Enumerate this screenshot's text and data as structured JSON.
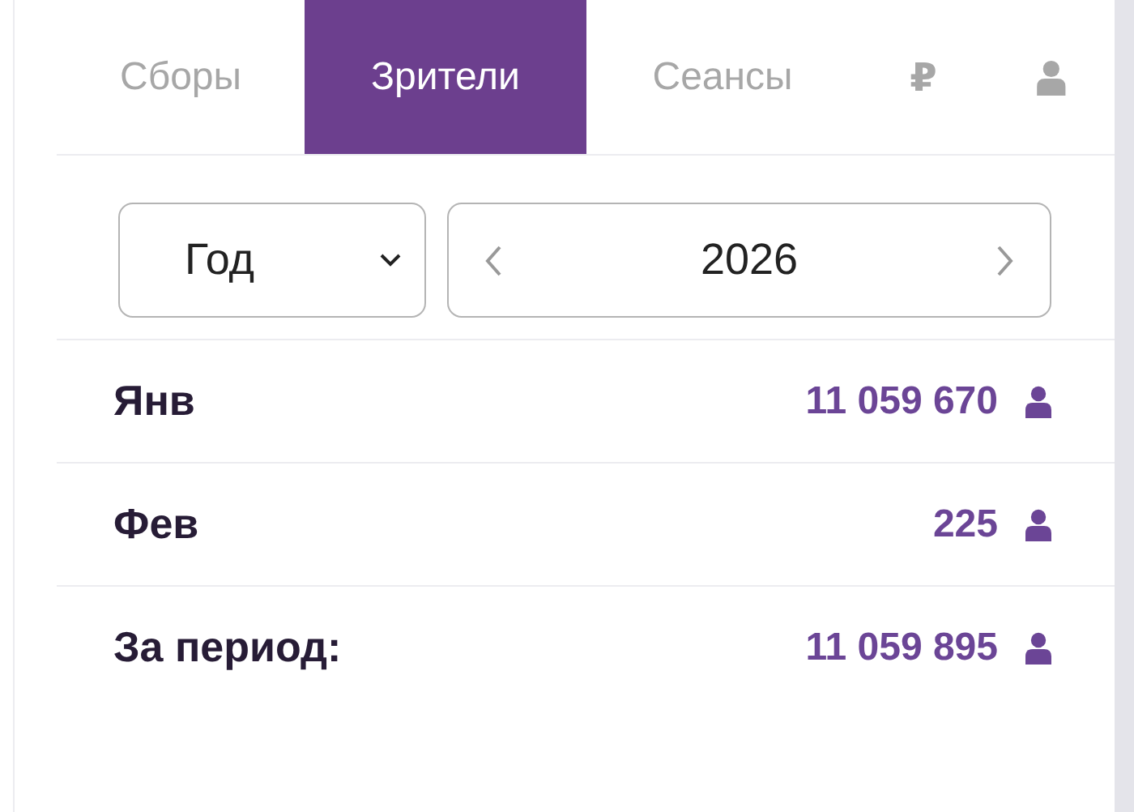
{
  "tabs": [
    {
      "kind": "text",
      "label": "Сборы",
      "selected": false
    },
    {
      "kind": "text",
      "label": "Зрители",
      "selected": true
    },
    {
      "kind": "text",
      "label": "Сеансы",
      "selected": false
    },
    {
      "kind": "text",
      "label": "₽",
      "selected": false
    },
    {
      "kind": "person-icon",
      "selected": false
    }
  ],
  "period_select": {
    "value": "Год"
  },
  "year_navigator": {
    "value": "2026"
  },
  "rows": [
    {
      "label": "Янв",
      "value": "11 059 670"
    },
    {
      "label": "Фев",
      "value": "225"
    },
    {
      "label": "За период:",
      "value": "11 059 895"
    }
  ]
}
